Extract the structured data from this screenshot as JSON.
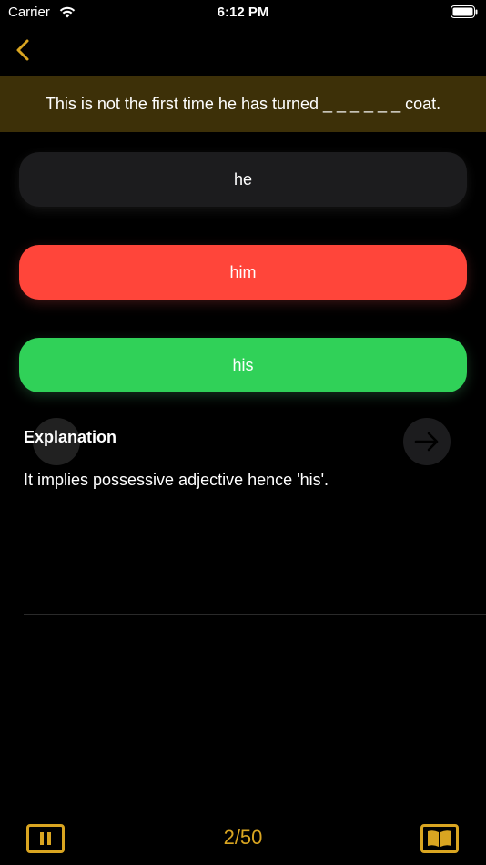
{
  "status_bar": {
    "carrier": "Carrier",
    "time": "6:12 PM"
  },
  "nav": {
    "back_icon": "chevron-left-icon"
  },
  "question": {
    "text": "This is not the first time he has turned _ _ _ _ _ _ coat."
  },
  "options": [
    {
      "label": "he",
      "state": "neutral",
      "color": "#1c1c1e"
    },
    {
      "label": "him",
      "state": "incorrect",
      "color": "#ff453a"
    },
    {
      "label": "his",
      "state": "correct",
      "color": "#30d158"
    }
  ],
  "explanation": {
    "heading": "Explanation",
    "text": "It implies possessive adjective hence 'his'."
  },
  "footer": {
    "progress": "2/50",
    "pause_icon": "pause-icon",
    "book_icon": "book-icon"
  },
  "colors": {
    "accent": "#d9a521",
    "banner": "#3d3008",
    "background": "#000000"
  }
}
